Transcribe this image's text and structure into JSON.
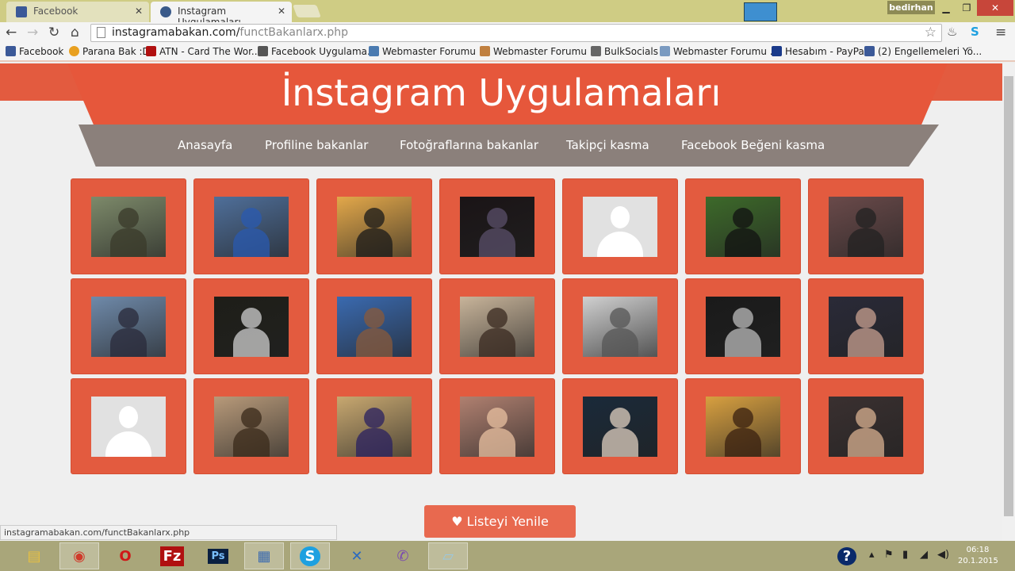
{
  "browser": {
    "tabs": [
      {
        "label": "Facebook",
        "active": false
      },
      {
        "label": "Instagram Uygulamaları",
        "active": true
      }
    ],
    "user": "bedirhan",
    "url_host": "instagramabakan.com/",
    "url_path": "functBakanlarx.php",
    "bookmarks": [
      "Facebook",
      "Parana Bak :D",
      "ATN - Card The Wor...",
      "Facebook Uygulama...",
      "Webmaster Forumu ...",
      "Webmaster Forumu ...",
      "BulkSocials",
      "Webmaster Forumu ...",
      "Hesabım - PayPal",
      "(2) Engellemeleri Yö..."
    ],
    "status_url": "instagramabakan.com/functBakanlarx.php"
  },
  "page": {
    "title": "İnstagram Uygulamaları",
    "nav": [
      "Anasayfa",
      "Profiline bakanlar",
      "Fotoğraflarına bakanlar",
      "Takipçi kasma",
      "Facebook Beğeni kasma"
    ],
    "profiles": [
      {
        "type": "photo",
        "bg": "#7d8a6a",
        "fg": "#3a3a2a"
      },
      {
        "type": "photo",
        "bg": "#4f6f9a",
        "fg": "#2a5ab0"
      },
      {
        "type": "photo",
        "bg": "#e3a84a",
        "fg": "#1a1a1a"
      },
      {
        "type": "photo",
        "bg": "#1a1416",
        "fg": "#5a4f6a"
      },
      {
        "type": "default"
      },
      {
        "type": "photo",
        "bg": "#3d6a2a",
        "fg": "#111"
      },
      {
        "type": "photo",
        "bg": "#6a4a4a",
        "fg": "#222"
      },
      {
        "type": "photo",
        "bg": "#6f8aaa",
        "fg": "#2a2a3a"
      },
      {
        "type": "photo",
        "bg": "#1e1e18",
        "fg": "#cfcfcf"
      },
      {
        "type": "photo",
        "bg": "#3a6ab0",
        "fg": "#8a5a3a"
      },
      {
        "type": "photo",
        "bg": "#c8b49a",
        "fg": "#3a2a20"
      },
      {
        "type": "photo",
        "bg": "#d0d0d0",
        "fg": "#555"
      },
      {
        "type": "photo",
        "bg": "#1a1a1a",
        "fg": "#bbb"
      },
      {
        "type": "photo",
        "bg": "#2a2a38",
        "fg": "#c8a090"
      },
      {
        "type": "default"
      },
      {
        "type": "photo",
        "bg": "#b89a7a",
        "fg": "#3a2a1a"
      },
      {
        "type": "photo",
        "bg": "#c8a870",
        "fg": "#2a2060"
      },
      {
        "type": "photo",
        "bg": "#b08070",
        "fg": "#e8c0a0"
      },
      {
        "type": "photo",
        "bg": "#1a2a3a",
        "fg": "#e0d0c0"
      },
      {
        "type": "photo",
        "bg": "#d8a040",
        "fg": "#3a2010"
      },
      {
        "type": "photo",
        "bg": "#3a3030",
        "fg": "#d8b090"
      }
    ],
    "refresh_label": "Listeyi Yenile"
  },
  "taskbar": {
    "apps": [
      "explorer",
      "chrome",
      "opera",
      "filezilla",
      "photoshop",
      "control-panel",
      "skype",
      "xampp",
      "viber",
      "notepad"
    ],
    "time": "06:18",
    "date": "20.1.2015"
  },
  "colors": {
    "accent": "#e35b3f",
    "nav": "#8b807b"
  }
}
